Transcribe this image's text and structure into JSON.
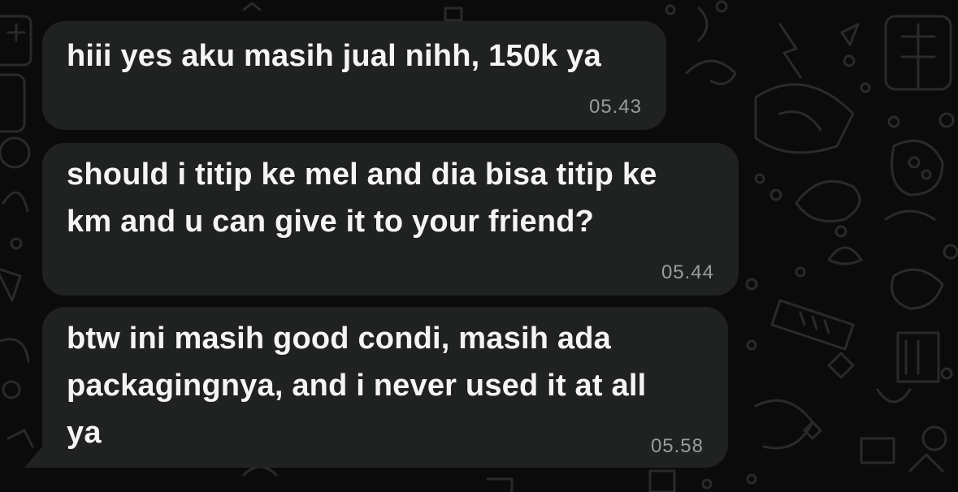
{
  "messages": [
    {
      "text": "hiii yes aku masih jual nihh, 150k ya",
      "time": "05.43"
    },
    {
      "text": "should i titip ke mel and dia bisa titip ke\nkm and u can give it to your friend?",
      "time": "05.44"
    },
    {
      "text": "btw ini masih good condi, masih ada\npackagingnya, and i never used it at all\nya",
      "time": "05.58"
    }
  ],
  "colors": {
    "background": "#0b0b0b",
    "bubble": "#202222",
    "text": "#f4f4f4",
    "timestamp": "#9a9d9e",
    "doodle": "#2a2a2a"
  }
}
